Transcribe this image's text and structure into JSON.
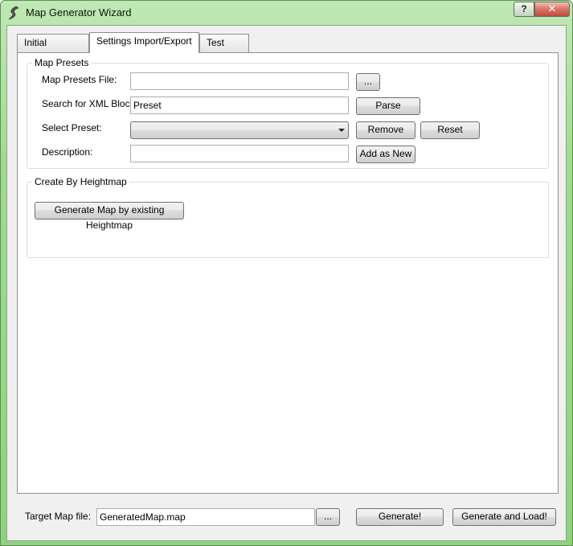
{
  "window": {
    "title": "Map Generator Wizard",
    "help_label": "?",
    "close_label": "✕"
  },
  "tabs": [
    {
      "label": "Initial Settings"
    },
    {
      "label": "Settings Import/Export"
    },
    {
      "label": "Test Tool"
    }
  ],
  "active_tab": "Settings Import/Export",
  "map_presets": {
    "title": "Map Presets",
    "file_label": "Map Presets File:",
    "file_value": "",
    "browse_label": "...",
    "xml_label": "Search for XML Block:",
    "xml_value": "Preset",
    "parse_label": "Parse",
    "select_label": "Select Preset:",
    "select_value": "",
    "remove_label": "Remove",
    "reset_label": "Reset",
    "description_label": "Description:",
    "description_value": "",
    "add_new_label": "Add as New"
  },
  "heightmap": {
    "title": "Create By Heightmap",
    "generate_label": "Generate Map by existing Heightmap"
  },
  "footer": {
    "target_label": "Target Map file:",
    "target_value": "GeneratedMap.map",
    "browse_label": "...",
    "generate_label": "Generate!",
    "generate_load_label": "Generate and Load!"
  },
  "colors": {
    "frame": "#9fdc8e",
    "dialog_bg": "#f0f0f0",
    "panel_bg": "#ffffff",
    "close_button": "#c04a3a"
  }
}
